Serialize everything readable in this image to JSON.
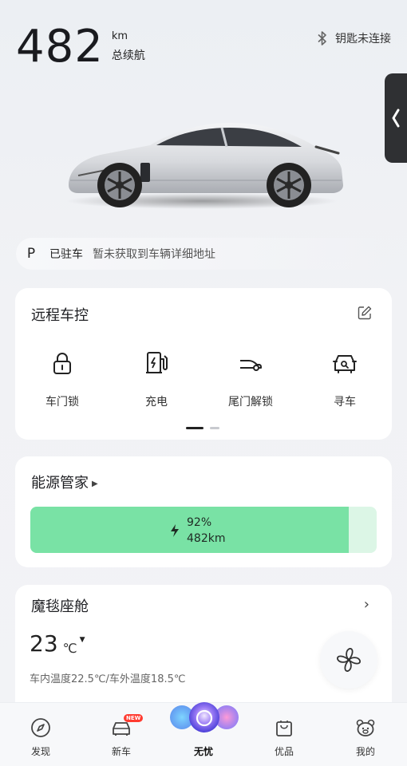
{
  "header": {
    "range_value": "482",
    "range_unit": "km",
    "range_label": "总续航",
    "key_status": "钥匙未连接"
  },
  "parking": {
    "gear": "P",
    "state": "已驻车",
    "address": "暂未获取到车辆详细地址"
  },
  "remote_control": {
    "title": "远程车控",
    "items": [
      {
        "label": "车门锁",
        "icon": "lock-icon"
      },
      {
        "label": "充电",
        "icon": "charger-icon"
      },
      {
        "label": "尾门解锁",
        "icon": "trunk-icon"
      },
      {
        "label": "寻车",
        "icon": "find-car-icon"
      }
    ],
    "pages": 2,
    "current_page": 1
  },
  "energy": {
    "title": "能源管家",
    "battery_percent_label": "92%",
    "battery_range": "482km",
    "battery_level": 0.92,
    "fill_color": "#79e2a5",
    "track_color": "#dcf6e6"
  },
  "cabin": {
    "title": "魔毯座舱",
    "temperature": "23",
    "temperature_unit": "℃",
    "temperature_detail": "车内温度22.5℃/车外温度18.5℃"
  },
  "tabbar": {
    "items": [
      {
        "label": "发现",
        "icon": "compass-icon"
      },
      {
        "label": "新车",
        "icon": "new-car-icon",
        "badge": "NEW"
      },
      {
        "label": "无忧",
        "icon": "orb-icon",
        "active": true
      },
      {
        "label": "优品",
        "icon": "shopping-bag-icon"
      },
      {
        "label": "我的",
        "icon": "bear-face-icon"
      }
    ]
  },
  "colors": {
    "accent_green": "#79e2a5",
    "side_tab": "#2f3033",
    "badge_red": "#ff3b30"
  }
}
